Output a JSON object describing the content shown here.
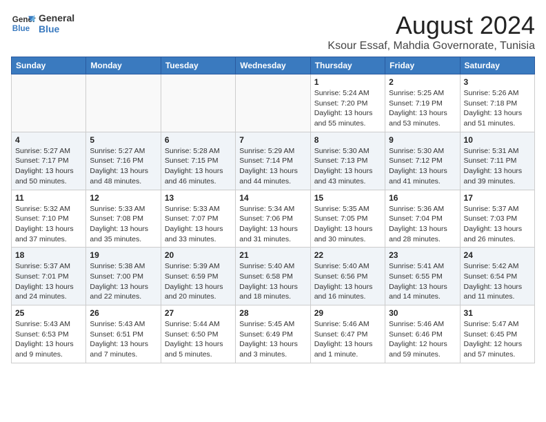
{
  "logo": {
    "line1": "General",
    "line2": "Blue"
  },
  "title": "August 2024",
  "subtitle": "Ksour Essaf, Mahdia Governorate, Tunisia",
  "days_of_week": [
    "Sunday",
    "Monday",
    "Tuesday",
    "Wednesday",
    "Thursday",
    "Friday",
    "Saturday"
  ],
  "weeks": [
    [
      {
        "day": "",
        "info": ""
      },
      {
        "day": "",
        "info": ""
      },
      {
        "day": "",
        "info": ""
      },
      {
        "day": "",
        "info": ""
      },
      {
        "day": "1",
        "info": "Sunrise: 5:24 AM\nSunset: 7:20 PM\nDaylight: 13 hours\nand 55 minutes."
      },
      {
        "day": "2",
        "info": "Sunrise: 5:25 AM\nSunset: 7:19 PM\nDaylight: 13 hours\nand 53 minutes."
      },
      {
        "day": "3",
        "info": "Sunrise: 5:26 AM\nSunset: 7:18 PM\nDaylight: 13 hours\nand 51 minutes."
      }
    ],
    [
      {
        "day": "4",
        "info": "Sunrise: 5:27 AM\nSunset: 7:17 PM\nDaylight: 13 hours\nand 50 minutes."
      },
      {
        "day": "5",
        "info": "Sunrise: 5:27 AM\nSunset: 7:16 PM\nDaylight: 13 hours\nand 48 minutes."
      },
      {
        "day": "6",
        "info": "Sunrise: 5:28 AM\nSunset: 7:15 PM\nDaylight: 13 hours\nand 46 minutes."
      },
      {
        "day": "7",
        "info": "Sunrise: 5:29 AM\nSunset: 7:14 PM\nDaylight: 13 hours\nand 44 minutes."
      },
      {
        "day": "8",
        "info": "Sunrise: 5:30 AM\nSunset: 7:13 PM\nDaylight: 13 hours\nand 43 minutes."
      },
      {
        "day": "9",
        "info": "Sunrise: 5:30 AM\nSunset: 7:12 PM\nDaylight: 13 hours\nand 41 minutes."
      },
      {
        "day": "10",
        "info": "Sunrise: 5:31 AM\nSunset: 7:11 PM\nDaylight: 13 hours\nand 39 minutes."
      }
    ],
    [
      {
        "day": "11",
        "info": "Sunrise: 5:32 AM\nSunset: 7:10 PM\nDaylight: 13 hours\nand 37 minutes."
      },
      {
        "day": "12",
        "info": "Sunrise: 5:33 AM\nSunset: 7:08 PM\nDaylight: 13 hours\nand 35 minutes."
      },
      {
        "day": "13",
        "info": "Sunrise: 5:33 AM\nSunset: 7:07 PM\nDaylight: 13 hours\nand 33 minutes."
      },
      {
        "day": "14",
        "info": "Sunrise: 5:34 AM\nSunset: 7:06 PM\nDaylight: 13 hours\nand 31 minutes."
      },
      {
        "day": "15",
        "info": "Sunrise: 5:35 AM\nSunset: 7:05 PM\nDaylight: 13 hours\nand 30 minutes."
      },
      {
        "day": "16",
        "info": "Sunrise: 5:36 AM\nSunset: 7:04 PM\nDaylight: 13 hours\nand 28 minutes."
      },
      {
        "day": "17",
        "info": "Sunrise: 5:37 AM\nSunset: 7:03 PM\nDaylight: 13 hours\nand 26 minutes."
      }
    ],
    [
      {
        "day": "18",
        "info": "Sunrise: 5:37 AM\nSunset: 7:01 PM\nDaylight: 13 hours\nand 24 minutes."
      },
      {
        "day": "19",
        "info": "Sunrise: 5:38 AM\nSunset: 7:00 PM\nDaylight: 13 hours\nand 22 minutes."
      },
      {
        "day": "20",
        "info": "Sunrise: 5:39 AM\nSunset: 6:59 PM\nDaylight: 13 hours\nand 20 minutes."
      },
      {
        "day": "21",
        "info": "Sunrise: 5:40 AM\nSunset: 6:58 PM\nDaylight: 13 hours\nand 18 minutes."
      },
      {
        "day": "22",
        "info": "Sunrise: 5:40 AM\nSunset: 6:56 PM\nDaylight: 13 hours\nand 16 minutes."
      },
      {
        "day": "23",
        "info": "Sunrise: 5:41 AM\nSunset: 6:55 PM\nDaylight: 13 hours\nand 14 minutes."
      },
      {
        "day": "24",
        "info": "Sunrise: 5:42 AM\nSunset: 6:54 PM\nDaylight: 13 hours\nand 11 minutes."
      }
    ],
    [
      {
        "day": "25",
        "info": "Sunrise: 5:43 AM\nSunset: 6:53 PM\nDaylight: 13 hours\nand 9 minutes."
      },
      {
        "day": "26",
        "info": "Sunrise: 5:43 AM\nSunset: 6:51 PM\nDaylight: 13 hours\nand 7 minutes."
      },
      {
        "day": "27",
        "info": "Sunrise: 5:44 AM\nSunset: 6:50 PM\nDaylight: 13 hours\nand 5 minutes."
      },
      {
        "day": "28",
        "info": "Sunrise: 5:45 AM\nSunset: 6:49 PM\nDaylight: 13 hours\nand 3 minutes."
      },
      {
        "day": "29",
        "info": "Sunrise: 5:46 AM\nSunset: 6:47 PM\nDaylight: 13 hours\nand 1 minute."
      },
      {
        "day": "30",
        "info": "Sunrise: 5:46 AM\nSunset: 6:46 PM\nDaylight: 12 hours\nand 59 minutes."
      },
      {
        "day": "31",
        "info": "Sunrise: 5:47 AM\nSunset: 6:45 PM\nDaylight: 12 hours\nand 57 minutes."
      }
    ]
  ]
}
